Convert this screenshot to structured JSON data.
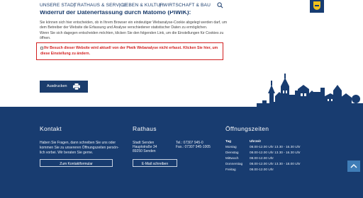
{
  "nav": {
    "items": [
      "UNSERE STADT",
      "RATHAUS & SERVICE",
      "LEBEN & KULTUR",
      "WIRTSCHAFT & BAU"
    ],
    "separator": "|"
  },
  "content": {
    "heading": "Widerruf der Datenerfassung durch Matomo (PIWIK):",
    "paragraph": [
      "Sie können sich hier entscheiden, ob in Ihrem Browser ein eindeutiger Webanalyse-Cookie abgelegt werden darf, um",
      "dem Betreiber der Website die Erfassung und Analyse verschiedener statistischer Daten zu ermöglichen.",
      "Wenn Sie sich dagegen entscheiden möchten, klicken Sie den folgenden Link, um die Einstellungen für Cookies zu",
      "öffnen."
    ],
    "optout_text": "Ihr Besuch dieser Website wird aktuell von der Piwik Webanalyse nicht erfasst. Klicken Sie hier, um diese Einstellung zu ändern.",
    "print_label": "Ausdrucken"
  },
  "footer": {
    "kontakt": {
      "title": "Kontakt",
      "lines": [
        "Haben Sie Fragen, dann schreiben Sie uns oder",
        "kommen Sie zu unsereren Öffnungszeiten persön-",
        "lich vorbei. Wir beraten Sie gerne."
      ],
      "button": "Zum Kontaktformular"
    },
    "rathaus": {
      "title": "Rathaus",
      "address": [
        "Stadt Senden",
        "Hauptstraße 34",
        "89250 Senden"
      ],
      "tel": "Tel.: 07307 945-0",
      "fax": "Fax.: 07307 945-1005",
      "button": "E-Mail schreiben"
    },
    "oeffnungszeiten": {
      "title": "Öffnungszeiten",
      "header": {
        "day": "Tag",
        "time": "Uhrzeit"
      },
      "rows": [
        {
          "day": "Montag",
          "time": "08.00-12.00 Uhr   13.30 - 16.30 Uhr"
        },
        {
          "day": "Dienstag",
          "time": "08.00-12.00 Uhr   13.30 - 16.30 Uhr"
        },
        {
          "day": "Mittwoch",
          "time": "08.00-12.00 Uhr"
        },
        {
          "day": "Donnerstag",
          "time": "08.00-12.00 Uhr   13.30 - 18.00 Uhr"
        },
        {
          "day": "Freitag",
          "time": "08.00-12.00 Uhr"
        }
      ]
    }
  },
  "colors": {
    "brand_blue": "#183c70",
    "optout_red": "#d21f1f",
    "crest_yellow": "#f1c21b",
    "scroll_button": "#3f7db7"
  },
  "icons": {
    "search": "search-icon",
    "print": "printer-icon",
    "scroll_top": "chevron-up-icon",
    "crest": "city-crest-icon"
  }
}
